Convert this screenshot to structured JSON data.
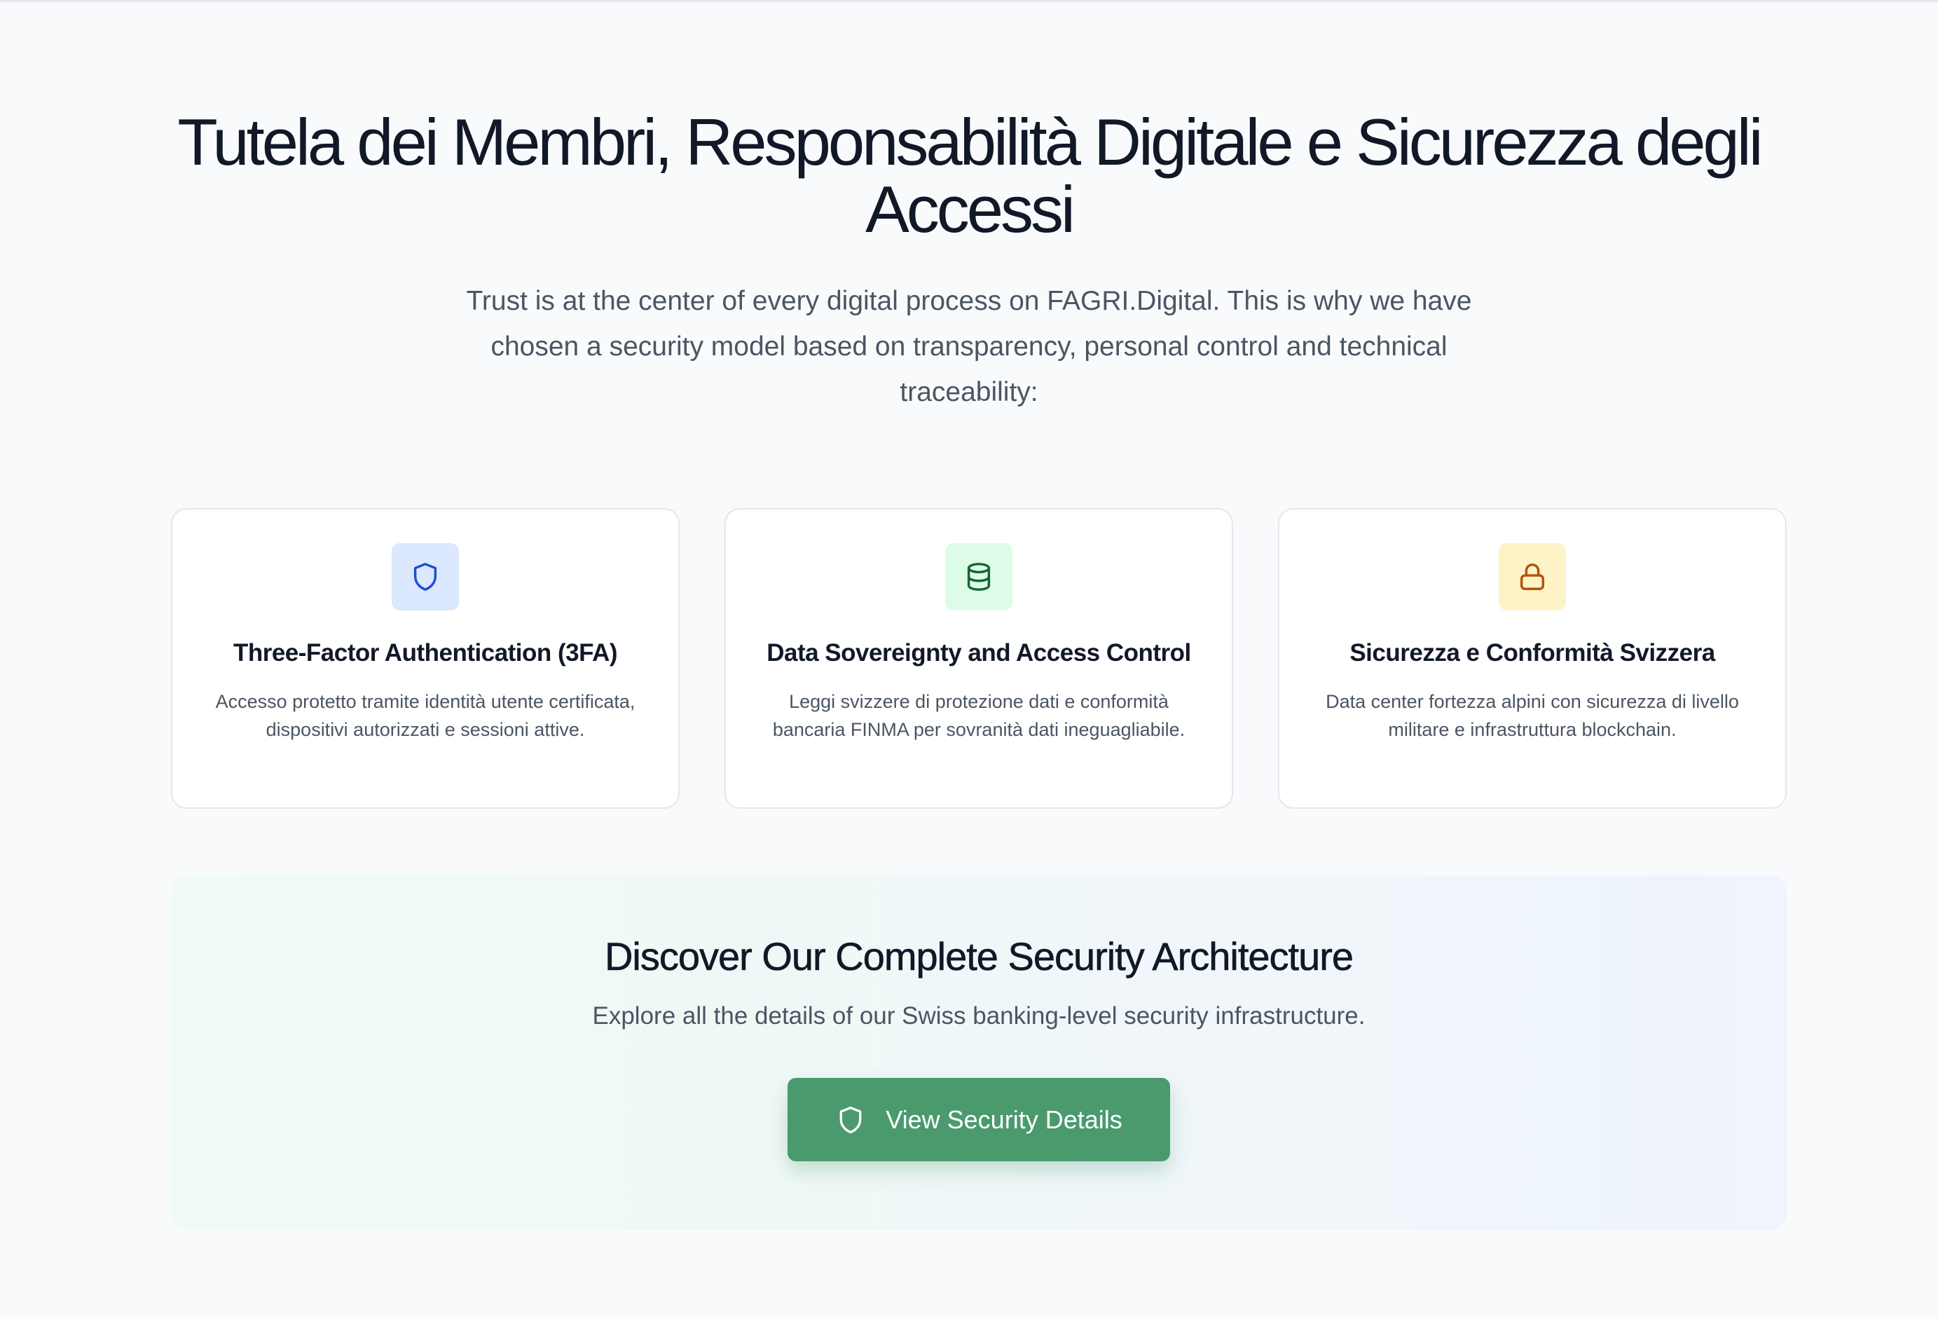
{
  "hero": {
    "title": "Tutela dei Membri, Responsabilità Digitale e Sicurezza degli Accessi",
    "subtitle": "Trust is at the center of every digital process on FAGRI.Digital. This is why we have chosen a security model based on transparency, personal control and technical traceability:"
  },
  "cards": [
    {
      "icon": "shield-icon",
      "icon_color": "#1d4ed8",
      "icon_bg": "#dbe8fd",
      "title": "Three-Factor Authentication (3FA)",
      "text": "Accesso protetto tramite identità utente certificata, dispositivi autorizzati e sessioni attive."
    },
    {
      "icon": "database-icon",
      "icon_color": "#166534",
      "icon_bg": "#dcfce7",
      "title": "Data Sovereignty and Access Control",
      "text": "Leggi svizzere di protezione dati e conformità bancaria FINMA per sovranità dati ineguagliabile."
    },
    {
      "icon": "lock-icon",
      "icon_color": "#b45309",
      "icon_bg": "#fef3c7",
      "title": "Sicurezza e Conformità Svizzera",
      "text": "Data center fortezza alpini con sicurezza di livello militare e infrastruttura blockchain."
    }
  ],
  "cta": {
    "title": "Discover Our Complete Security Architecture",
    "text": "Explore all the details of our Swiss banking-level security infrastructure.",
    "button_label": "View Security Details",
    "button_icon": "shield-icon",
    "button_color": "#4a9a6e"
  }
}
